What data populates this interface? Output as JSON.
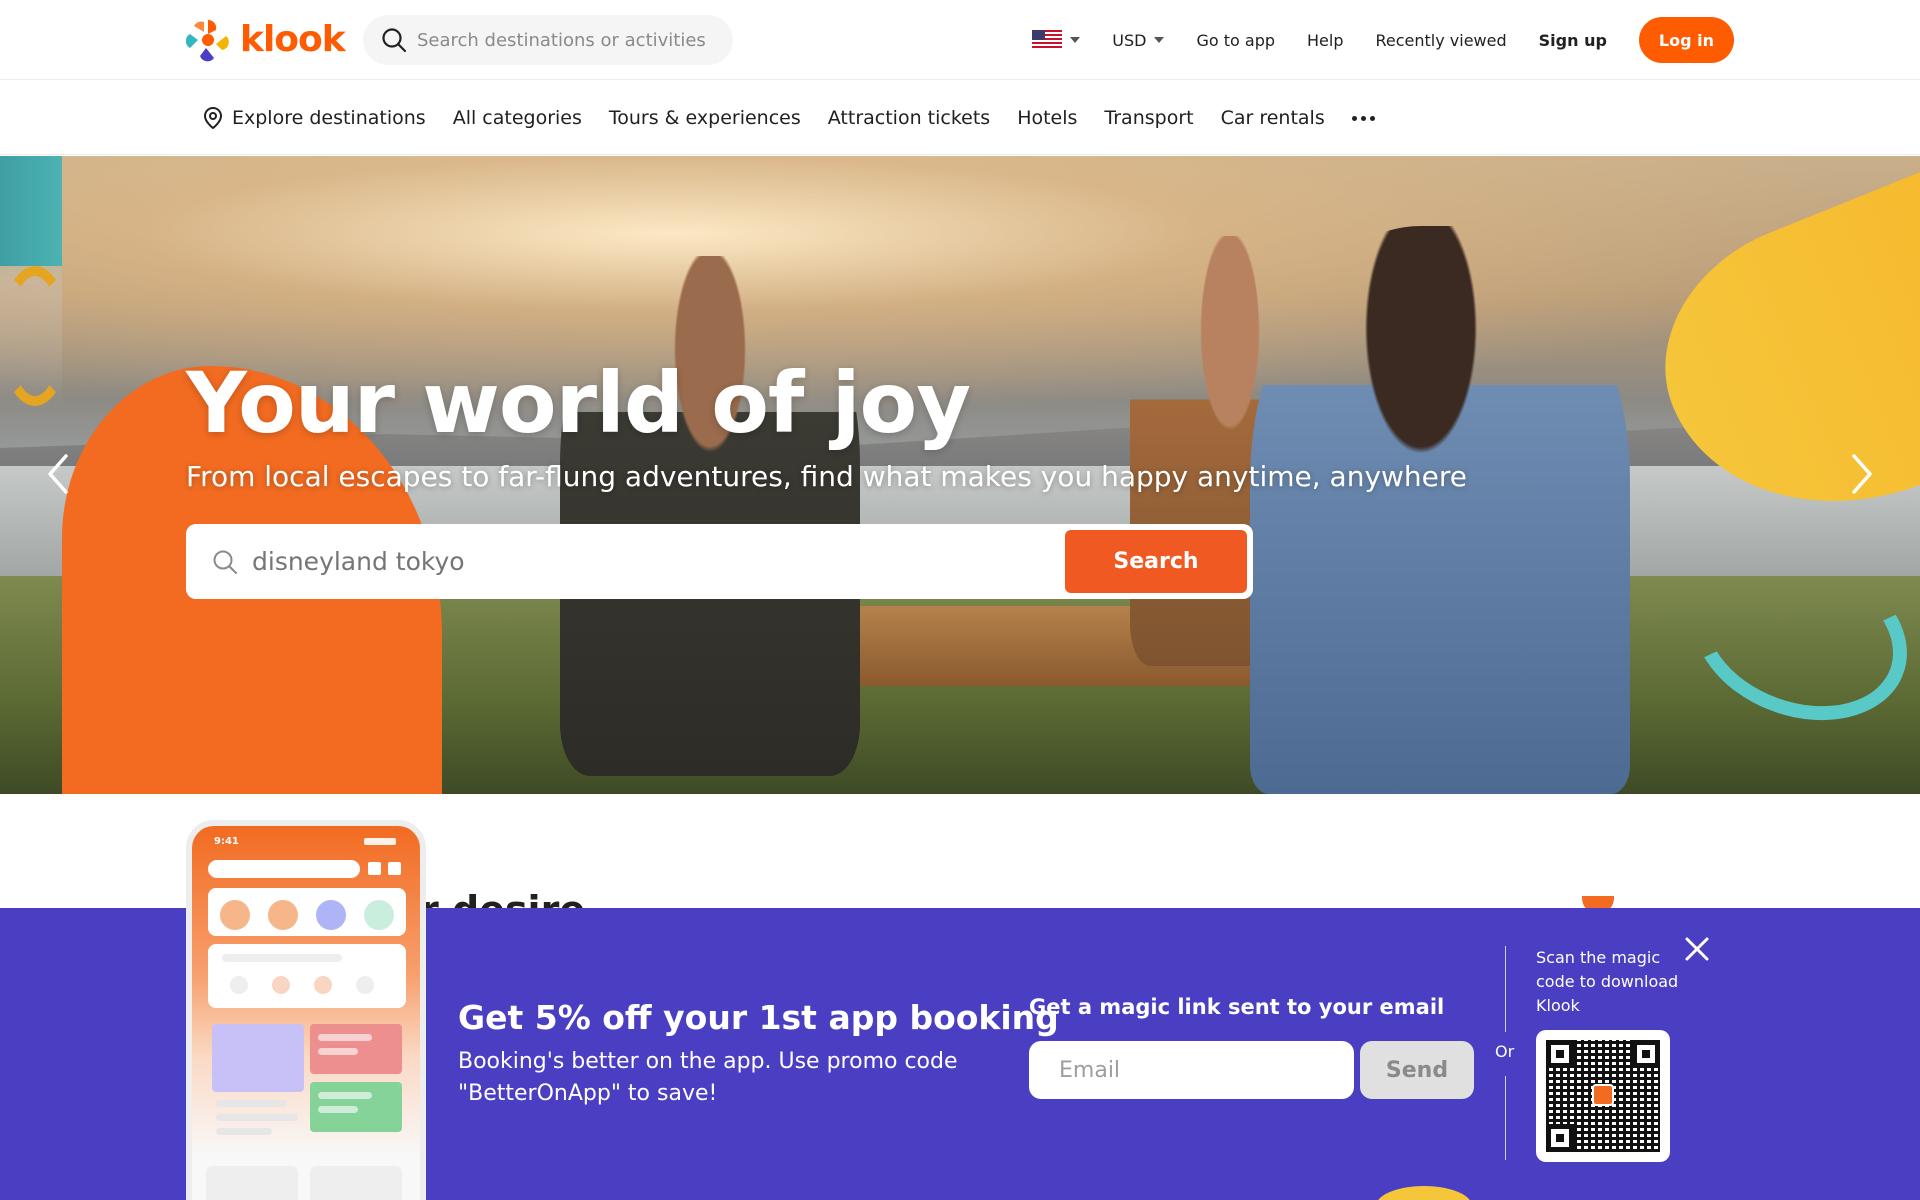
{
  "brand": {
    "name": "klook",
    "accent": "#ff5b00",
    "promo_bg": "#4a3ec2"
  },
  "header": {
    "search_placeholder": "Search destinations or activities",
    "flag_icon": "us-flag-icon",
    "currency": "USD",
    "links": {
      "go_to_app": "Go to app",
      "help": "Help",
      "recently_viewed": "Recently viewed",
      "sign_up": "Sign up"
    },
    "login": "Log in"
  },
  "nav": {
    "explore": "Explore destinations",
    "items": [
      "All categories",
      "Tours & experiences",
      "Attraction tickets",
      "Hotels",
      "Transport",
      "Car rentals"
    ]
  },
  "hero": {
    "title": "Your world of joy",
    "subtitle": "From local escapes to far-flung adventures, find what makes you happy anytime, anywhere",
    "search_value": "disneyland tokyo",
    "search_button": "Search"
  },
  "section": {
    "title_partial": "r desire"
  },
  "promo": {
    "title": "Get 5% off your 1st app booking",
    "description": "Booking's better on the app. Use promo code \"BetterOnApp\" to save!",
    "magic_link_title": "Get a magic link sent to your email",
    "email_placeholder": "Email",
    "send_button": "Send",
    "or_text": "Or",
    "scan_text": "Scan the magic code to download Klook"
  },
  "phone": {
    "time": "9:41"
  }
}
